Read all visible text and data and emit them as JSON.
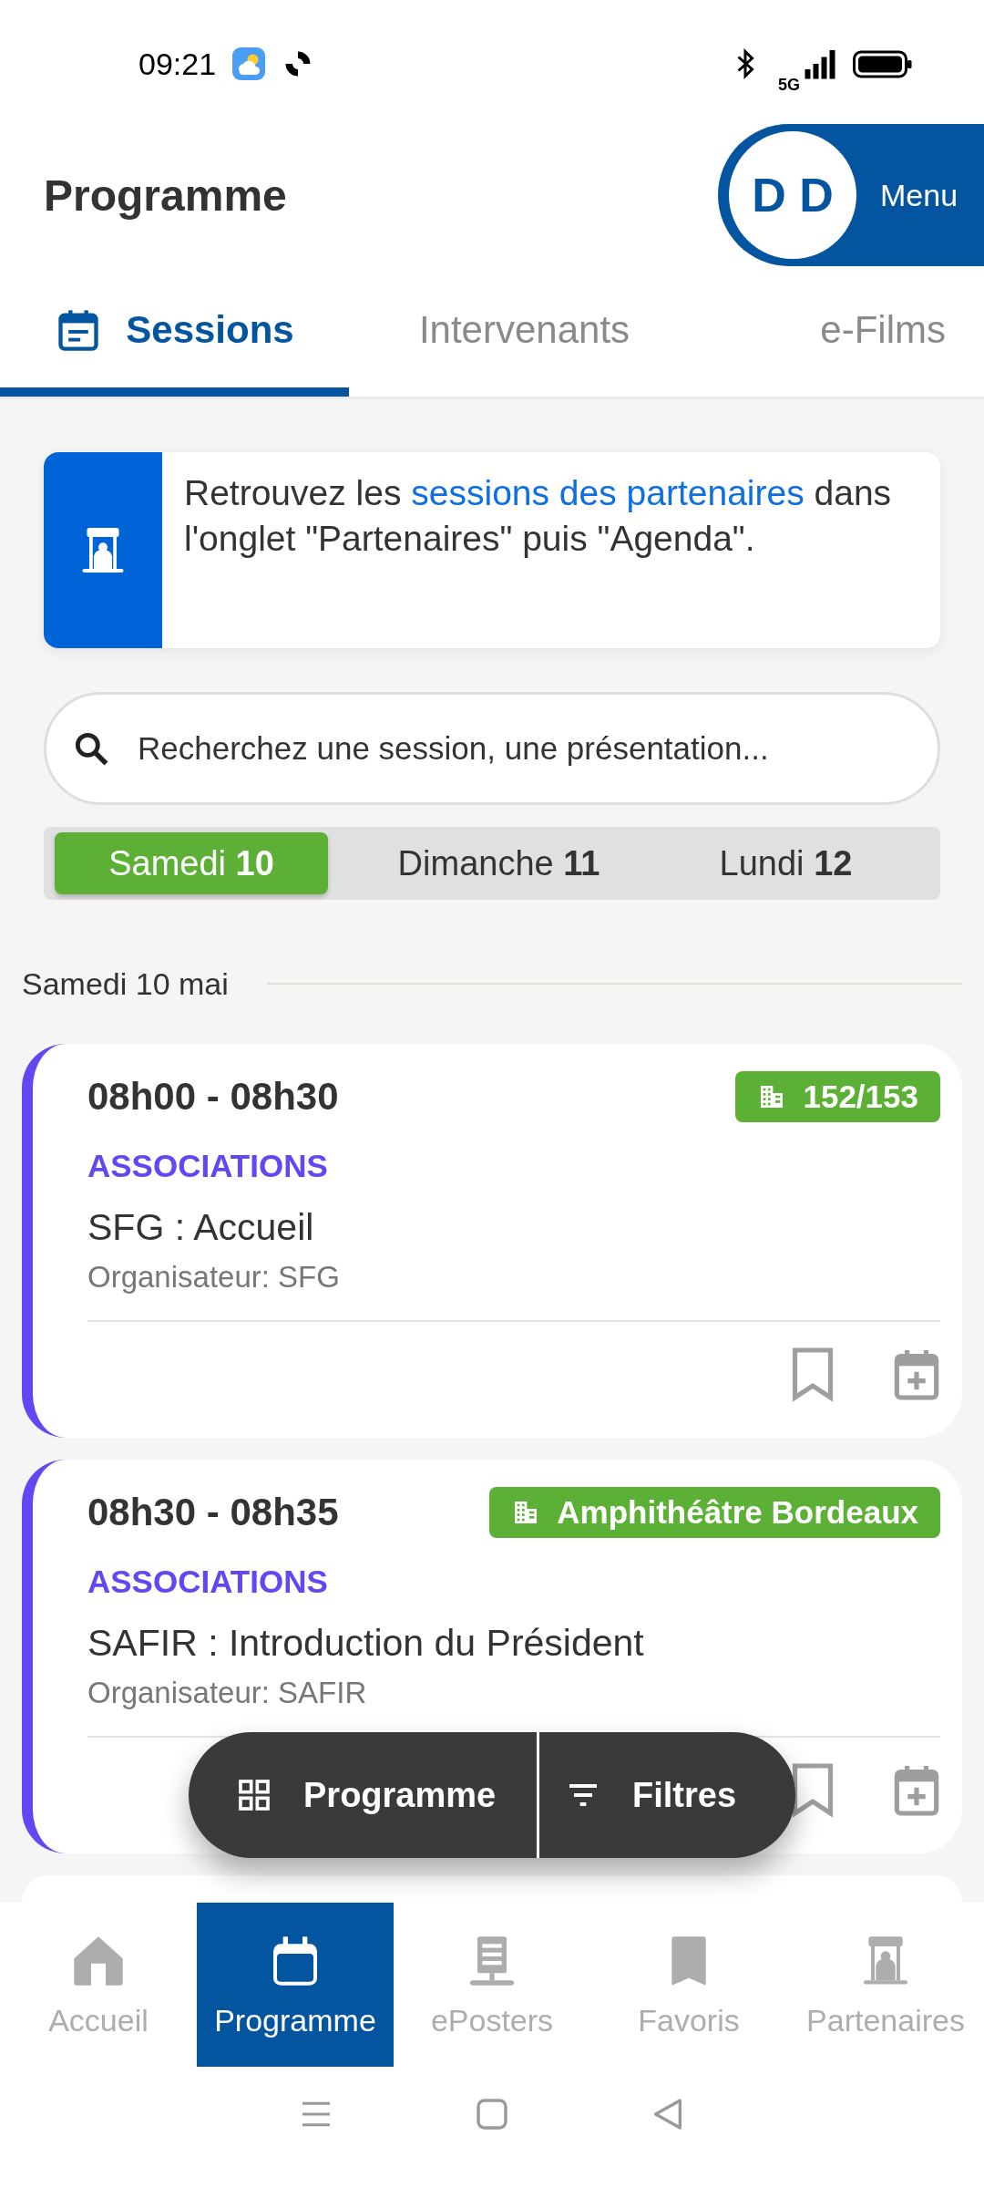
{
  "status_bar": {
    "time": "09:21",
    "network": "5G"
  },
  "header": {
    "title": "Programme",
    "avatar_initials": "D D",
    "menu_label": "Menu"
  },
  "tabs": [
    {
      "label": "Sessions",
      "selected": true
    },
    {
      "label": "Intervenants",
      "selected": false
    },
    {
      "label": "e-Films",
      "selected": false
    }
  ],
  "banner": {
    "text_before": "Retrouvez les ",
    "link": "sessions des partenaires",
    "text_after": " dans l'onglet \"Partenaires\" puis \"Agenda\"."
  },
  "search": {
    "placeholder": "Recherchez une session, une présentation..."
  },
  "days": [
    {
      "label": "Samedi",
      "number": "10",
      "selected": true
    },
    {
      "label": "Dimanche",
      "number": "11",
      "selected": false
    },
    {
      "label": "Lundi",
      "number": "12",
      "selected": false
    }
  ],
  "section_label": "Samedi 10 mai",
  "sessions": [
    {
      "time": "08h00 - 08h30",
      "room": "152/153",
      "category": "ASSOCIATIONS",
      "title": "SFG : Accueil",
      "organizer": "Organisateur: SFG",
      "bookmarked": false
    },
    {
      "time": "08h30 - 08h35",
      "room": "Amphithéâtre Bordeaux",
      "category": "ASSOCIATIONS",
      "title": "SAFIR : Introduction du Président",
      "organizer": "Organisateur: SAFIR",
      "bookmarked": false
    }
  ],
  "floating_bar": [
    {
      "kind": "grid",
      "label": "Programme"
    },
    {
      "kind": "filter",
      "label": "Filtres"
    }
  ],
  "bottom_nav": [
    {
      "kind": "home",
      "label": "Accueil",
      "selected": false
    },
    {
      "kind": "calendar",
      "label": "Programme",
      "selected": true
    },
    {
      "kind": "poster",
      "label": "ePosters",
      "selected": false
    },
    {
      "kind": "bookmark",
      "label": "Favoris",
      "selected": false
    },
    {
      "kind": "booth",
      "label": "Partenaires",
      "selected": false
    }
  ]
}
